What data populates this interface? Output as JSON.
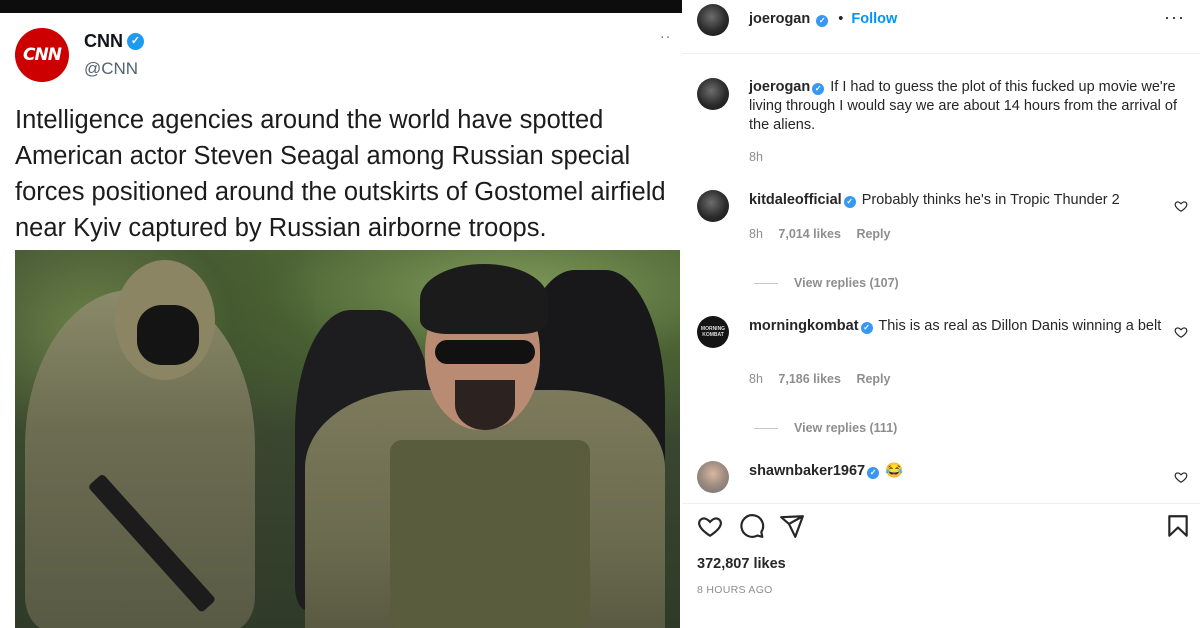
{
  "tweet": {
    "logo_text": "CNN",
    "name": "CNN",
    "handle": "@CNN",
    "more": "··",
    "text": "Intelligence agencies around the world have spotted American actor Steven Seagal among Russian special forces positioned around the outskirts of Gostomel airfield near Kyiv captured by Russian airborne troops."
  },
  "post": {
    "author": "joerogan",
    "follow_label": "Follow",
    "dot": "•",
    "more": "···",
    "caption": {
      "user": "joerogan",
      "text": "If I had to guess the plot of this fucked up movie we're living through I would say we are about 14 hours from the arrival of the aliens.",
      "time": "8h"
    },
    "comments": [
      {
        "user": "kitdaleofficial",
        "text": "Probably thinks he's in Tropic Thunder 2",
        "time": "8h",
        "likes": "7,014 likes",
        "reply_label": "Reply",
        "view_replies": "View replies (107)"
      },
      {
        "user": "morningkombat",
        "avatar_text": "MORNING KOMBAT",
        "text": "This is as real as Dillon Danis winning a belt",
        "time": "8h",
        "likes": "7,186 likes",
        "reply_label": "Reply",
        "view_replies": "View replies (111)"
      },
      {
        "user": "shawnbaker1967",
        "text": "😂"
      }
    ],
    "likes": "372,807 likes",
    "time_ago": "8 HOURS AGO"
  },
  "icons": [
    "verified-badge-icon",
    "heart-icon",
    "comment-icon",
    "share-icon",
    "bookmark-icon",
    "more-icon"
  ],
  "colors": {
    "cnn_red": "#cc0000",
    "twitter_blue": "#1d9bf0",
    "instagram_link": "#0095f6",
    "muted": "#8e8e8e"
  }
}
